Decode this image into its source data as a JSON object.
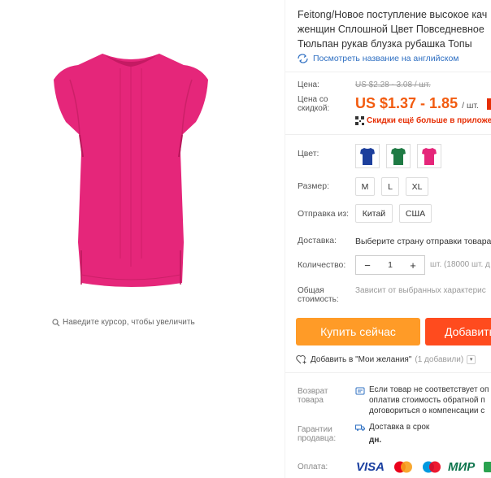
{
  "gallery": {
    "zoom_hint": "Наведите курсор, чтобы увеличить",
    "product_color": "#e5267a"
  },
  "product": {
    "title_lines": [
      "Feitong/Новое поступление высокое кач",
      "женщин Сплошной Цвет Повседневное",
      "Тюльпан рукав блузка рубашка Топы"
    ],
    "translate_link": "Посмотреть название на английском"
  },
  "price": {
    "label": "Цена:",
    "old": "US $2.28 - 3.08 / шт.",
    "discount_label_1": "Цена со",
    "discount_label_2": "скидкой:",
    "sale": "US $1.37 - 1.85",
    "unit": "/ шт.",
    "app_promo": "Скидки ещё больше в приложе"
  },
  "options": {
    "color_label": "Цвет:",
    "colors": [
      {
        "name": "blue",
        "hex": "#1d3f9c"
      },
      {
        "name": "green",
        "hex": "#1f7a44"
      },
      {
        "name": "pink",
        "hex": "#e5267a"
      }
    ],
    "size_label": "Размер:",
    "sizes": [
      "M",
      "L",
      "XL"
    ],
    "ship_from_label": "Отправка из:",
    "ship_from": [
      "Китай",
      "США"
    ],
    "delivery_label": "Доставка:",
    "delivery_text": "Выберите страну отправки товара",
    "quantity_label": "Количество:",
    "quantity": "1",
    "minus": "−",
    "plus": "+",
    "stock": "шт. (18000 шт. д",
    "total_label_1": "Общая",
    "total_label_2": "стоимость:",
    "total_text": "Зависит от выбранных характерис"
  },
  "actions": {
    "buy_now": "Купить сейчас",
    "add_to_cart": "Добавить",
    "wishlist": "Добавить в \"Мои желания\"",
    "wishlist_count": "(1 добавили)"
  },
  "guarantees": {
    "return_label_1": "Возврат",
    "return_label_2": "товара",
    "return_text": [
      "Если товар не соответствует оп",
      "оплатив стоимость обратной п",
      "договориться о компенсации с"
    ],
    "seller_label_1": "Гарантии",
    "seller_label_2": "продавца:",
    "seller_text_1": "Доставка в срок",
    "seller_text_2": "дн.",
    "payment_label": "Оплата:",
    "payment_methods": [
      "VISA",
      "МИР"
    ]
  }
}
